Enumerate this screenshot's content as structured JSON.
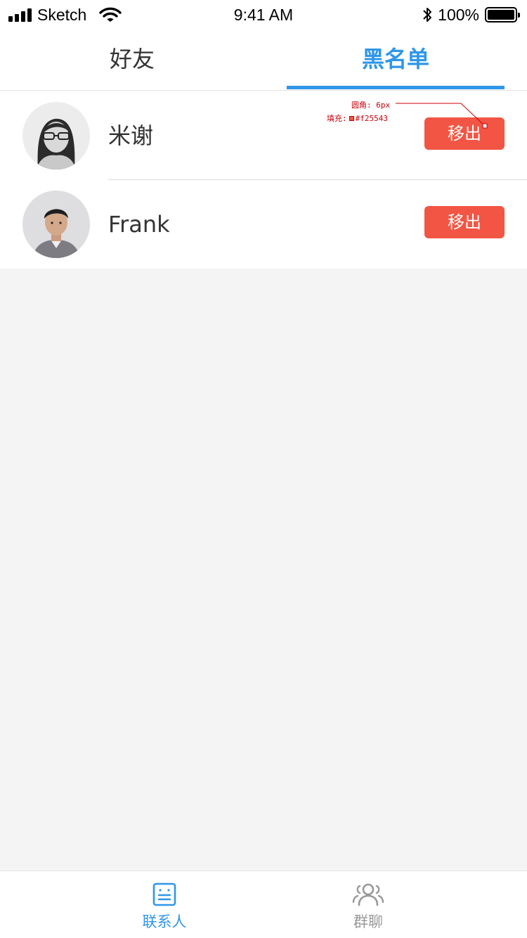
{
  "status_bar": {
    "carrier": "Sketch",
    "time": "9:41 AM",
    "battery": "100%"
  },
  "tabs": [
    {
      "label": "好友",
      "active": false
    },
    {
      "label": "黑名单",
      "active": true
    }
  ],
  "blacklist": [
    {
      "name": "米谢",
      "action": "移出"
    },
    {
      "name": "Frank",
      "action": "移出"
    }
  ],
  "annotation": {
    "radius": "圆角: 6px",
    "fill_label": "填充:",
    "fill_value": "#f25543"
  },
  "tabbar": {
    "items": [
      {
        "label": "联系人",
        "icon": "contacts-icon",
        "active": true
      },
      {
        "label": "群聊",
        "icon": "group-chat-icon",
        "active": false
      }
    ]
  },
  "colors": {
    "accent": "#2f96e9",
    "remove_button": "#f25543",
    "background": "#f4f4f4"
  }
}
